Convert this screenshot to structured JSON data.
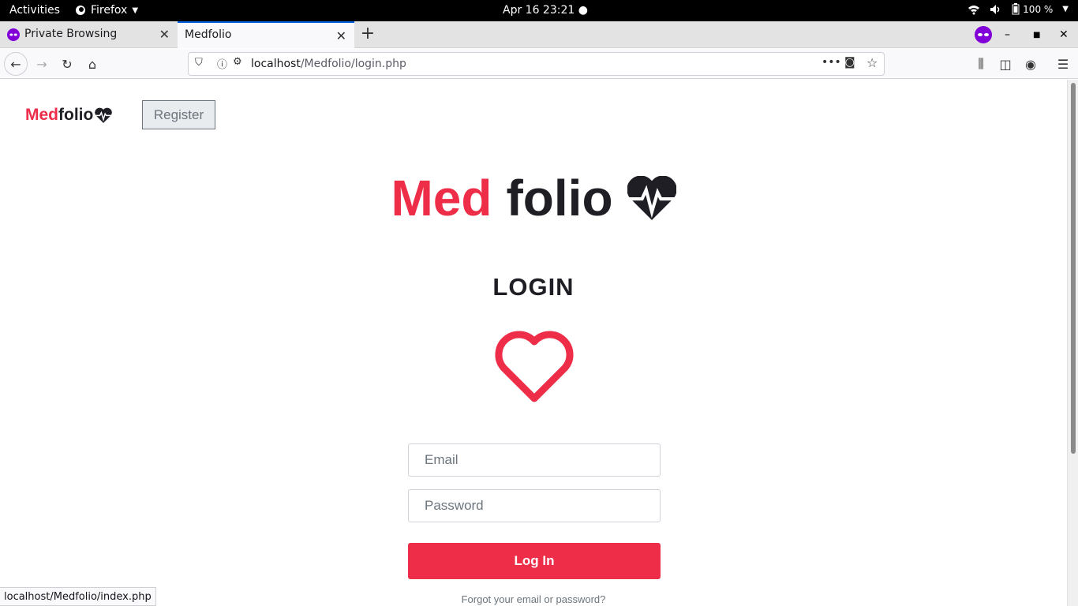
{
  "system": {
    "activities": "Activities",
    "app_name": "Firefox",
    "clock": "Apr 16  23:21",
    "battery": "100 %"
  },
  "browser": {
    "tabs": [
      {
        "title": "Private Browsing"
      },
      {
        "title": "Medfolio"
      }
    ],
    "url_host": "localhost",
    "url_path": "/Medfolio/login.php",
    "status_url": "localhost/Medfolio/index.php"
  },
  "page": {
    "brand_med": "Med",
    "brand_folio": "folio",
    "register_label": "Register",
    "hero_med": "Med",
    "hero_folio": "folio",
    "login_title": "LOGIN",
    "email_placeholder": "Email",
    "password_placeholder": "Password",
    "login_button": "Log In",
    "forgot_link": "Forgot your email or password?"
  },
  "colors": {
    "accent": "#ee2e48",
    "dark": "#1e1e24"
  }
}
